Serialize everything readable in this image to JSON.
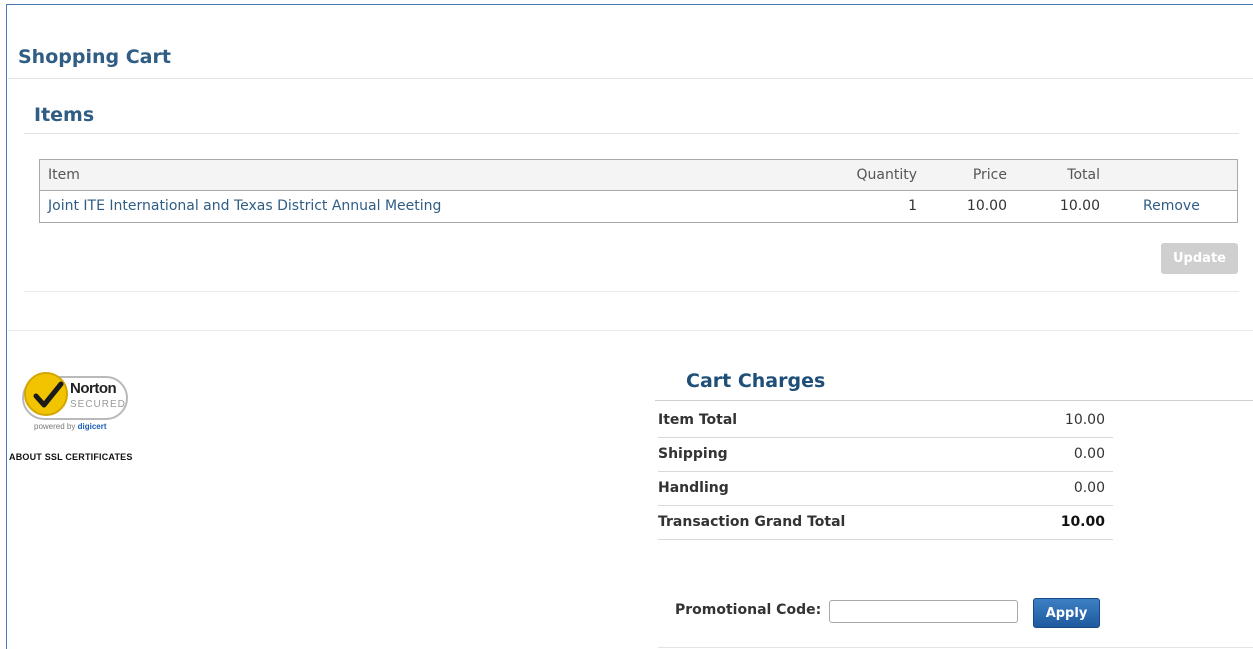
{
  "page": {
    "title": "Shopping Cart"
  },
  "items_section": {
    "title": "Items",
    "columns": {
      "item": "Item",
      "quantity": "Quantity",
      "price": "Price",
      "total": "Total"
    },
    "rows": [
      {
        "item": "Joint ITE International and Texas District Annual Meeting",
        "quantity": "1",
        "price": "10.00",
        "total": "10.00",
        "remove": "Remove"
      }
    ],
    "update_label": "Update"
  },
  "security": {
    "norton_word": "Norton",
    "norton_secured": "SECURED",
    "powered_by": "powered by",
    "powered_brand": "digicert",
    "about_link": "ABOUT SSL CERTIFICATES"
  },
  "cart_charges": {
    "title": "Cart Charges",
    "rows": [
      {
        "label": "Item Total",
        "value": "10.00"
      },
      {
        "label": "Shipping",
        "value": "0.00"
      },
      {
        "label": "Handling",
        "value": "0.00"
      },
      {
        "label": "Transaction Grand Total",
        "value": "10.00"
      }
    ]
  },
  "promo": {
    "label": "Promotional Code:",
    "value": "",
    "apply_label": "Apply"
  },
  "colors": {
    "heading": "#2f5d84",
    "link": "#2f5d84",
    "apply": "#1e5a9e",
    "update_disabled": "#cfcfcf",
    "norton_yellow": "#f2c400"
  }
}
